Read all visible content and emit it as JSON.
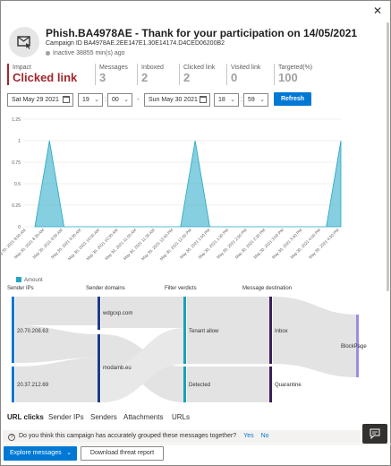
{
  "header": {
    "title": "Phish.BA4978AE - Thank for your participation on 14/05/2021",
    "campaign_id": "Campaign ID BA4978AE.2EE147E1.30E14174.D4CED06200B2",
    "status": "Inactive 38855 min(s) ago"
  },
  "metrics": [
    {
      "label": "Impact",
      "value": "Clicked link"
    },
    {
      "label": "Messages",
      "value": "3"
    },
    {
      "label": "Inboxed",
      "value": "2"
    },
    {
      "label": "Clicked link",
      "value": "2"
    },
    {
      "label": "Visited link",
      "value": "0"
    },
    {
      "label": "Targeted(%)",
      "value": "100"
    }
  ],
  "filters": {
    "start_date": "Sat May 29 2021",
    "start_hour": "19",
    "start_minute": "00",
    "end_date": "Sun May 30 2021",
    "end_hour": "18",
    "end_minute": "59",
    "refresh_label": "Refresh"
  },
  "chart_data": {
    "type": "area",
    "categories": [
      "May 30, 2021 8:00 AM",
      "May 30, 2021 9:00 AM",
      "May 30, 2021 10:00 AM",
      "May 30, 2021 11:00 AM",
      "May 30, 2021 12:00 PM",
      "May 30, 2021 1:00 PM",
      "May 30, 2021 2:00 PM",
      "May 30, 2021 3:00 PM",
      "May 30, 2021 4:00 PM"
    ],
    "x_tick_labels": [
      "May 30, 2021 8:00 AM",
      "May 30, 2021 8:30 AM",
      "May 30, 2021 9:00 AM",
      "May 30, 2021 9:30 AM",
      "May 30, 2021 10:00 AM",
      "May 30, 2021 10:30 AM",
      "May 30, 2021 11:00 AM",
      "May 30, 2021 11:30 AM",
      "May 30, 2021 12:00 PM",
      "May 30, 2021 12:30 PM",
      "May 30, 2021 1:00 PM",
      "May 30, 2021 1:30 PM",
      "May 30, 2021 2:00 PM",
      "May 30, 2021 2:30 PM",
      "May 30, 2021 3:00 PM",
      "May 30, 2021 3:30 PM",
      "May 30, 2021 4:00 PM",
      "May 30, 2021 4:30 PM"
    ],
    "series": [
      {
        "name": "Amount",
        "values": [
          0,
          1,
          0,
          0,
          0,
          0,
          0,
          0,
          0,
          0,
          0,
          1,
          0,
          0,
          0,
          0,
          0,
          0,
          0,
          0,
          0,
          1
        ]
      }
    ],
    "y_ticks": [
      "0",
      "0.25",
      "0.5",
      "0.75",
      "1",
      "1.25"
    ],
    "ylim": [
      0,
      1.25
    ],
    "grid": true,
    "legend": "bottom-left",
    "color": "#23a7c7"
  },
  "flow": {
    "columns": [
      "Sender IPs",
      "Sender domains",
      "Filter verdicts",
      "Message destination"
    ],
    "nodes": {
      "ip1": "20.70.208.63",
      "ip2": "20.37.212.69",
      "dom1": "wdgcxp.com",
      "dom2": "modamb.eu",
      "ver1": "Tenant allow",
      "ver2": "Detected",
      "dest1": "Inbox",
      "dest2": "Quarantine",
      "dest3": "BlockPage"
    }
  },
  "tabs": [
    "URL clicks",
    "Sender IPs",
    "Senders",
    "Attachments",
    "URLs"
  ],
  "feedback": {
    "question": "Do you think this campaign has accurately grouped these messages together?",
    "yes": "Yes",
    "no": "No"
  },
  "footer": {
    "explore_label": "Explore messages",
    "download_label": "Download threat report"
  },
  "icons": {
    "close": "close-icon",
    "campaign": "campaign-icon",
    "calendar": "calendar-icon",
    "chevron": "chevron-down-icon",
    "chat": "chat-icon",
    "question": "question-icon"
  }
}
